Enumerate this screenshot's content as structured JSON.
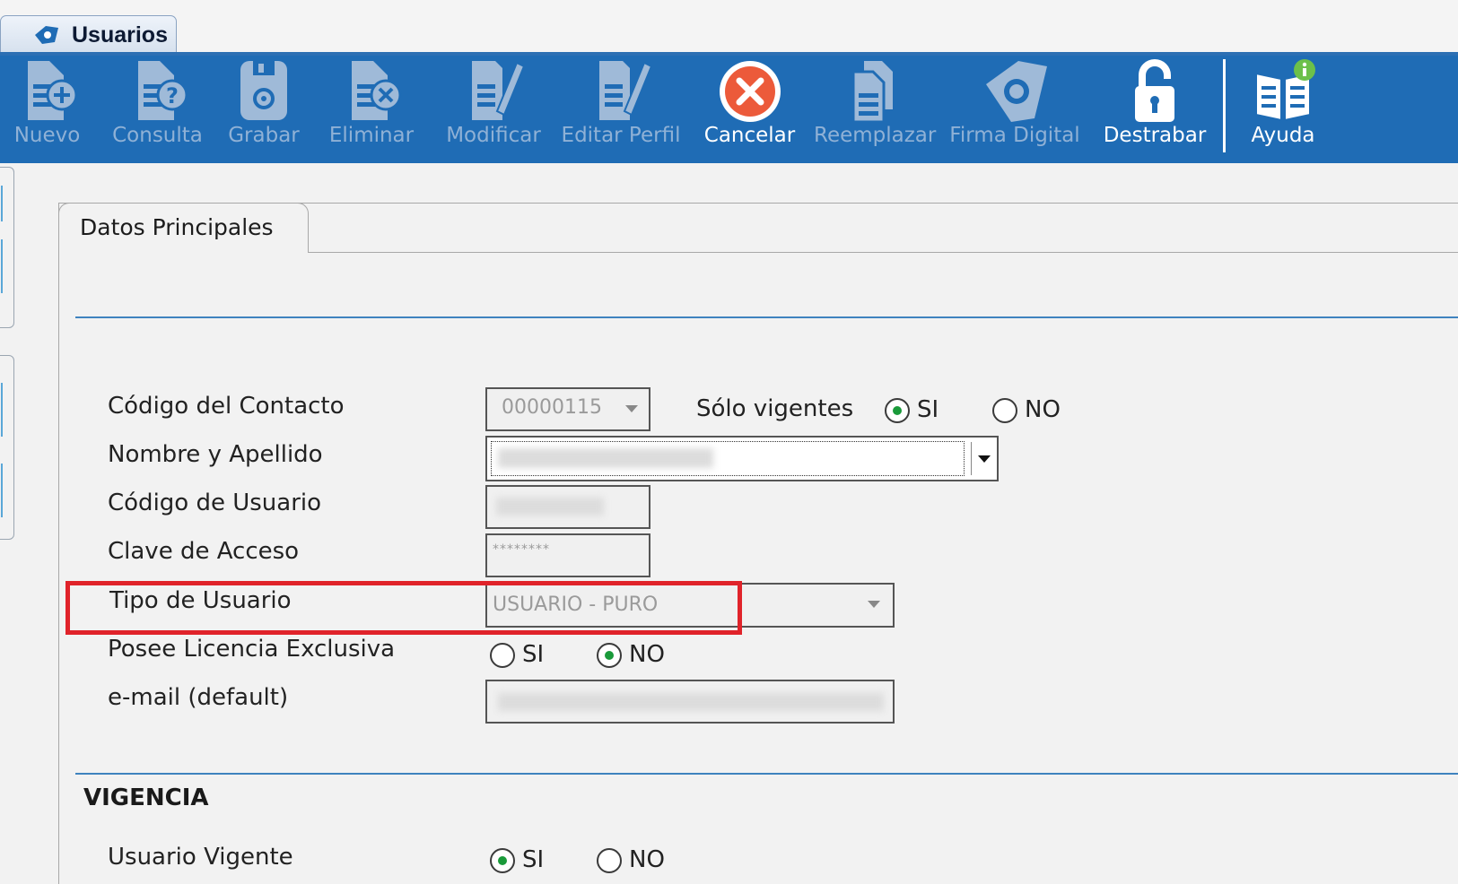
{
  "window_tab": {
    "title": "Usuarios"
  },
  "toolbar": {
    "buttons": [
      {
        "label": "Nuevo",
        "enabled": false
      },
      {
        "label": "Consulta",
        "enabled": false
      },
      {
        "label": "Grabar",
        "enabled": false
      },
      {
        "label": "Eliminar",
        "enabled": false
      },
      {
        "label": "Modificar",
        "enabled": false
      },
      {
        "label": "Editar Perfil",
        "enabled": false
      },
      {
        "label": "Cancelar",
        "enabled": true
      },
      {
        "label": "Reemplazar",
        "enabled": false
      },
      {
        "label": "Firma Digital",
        "enabled": false
      },
      {
        "label": "Destrabar",
        "enabled": true
      },
      {
        "label": "Ayuda",
        "enabled": true
      }
    ]
  },
  "content": {
    "tab_label": "Datos Principales",
    "fields": {
      "codigo_contacto": {
        "label": "Código del Contacto",
        "value": "00000115"
      },
      "solo_vigentes": {
        "label": "Sólo vigentes",
        "yes": "SI",
        "no": "NO",
        "selected": "SI"
      },
      "nombre_apellido": {
        "label": "Nombre y Apellido"
      },
      "codigo_usuario": {
        "label": "Código de Usuario"
      },
      "clave_acceso": {
        "label": "Clave de Acceso",
        "value": "********"
      },
      "tipo_usuario": {
        "label": "Tipo de Usuario",
        "value": "USUARIO - PURO"
      },
      "licencia_exclusiva": {
        "label": "Posee Licencia Exclusiva",
        "yes": "SI",
        "no": "NO",
        "selected": "NO"
      },
      "email_default": {
        "label": "e-mail (default)"
      }
    },
    "vigencia": {
      "title": "VIGENCIA",
      "usuario_vigente": {
        "label": "Usuario Vigente",
        "yes": "SI",
        "no": "NO",
        "selected": "SI"
      }
    }
  },
  "colors": {
    "toolbar_bg": "#1f6cb5",
    "disabled_label": "#8fb1d6",
    "highlight": "#e0232a",
    "radio_dot": "#1a9a3a"
  }
}
